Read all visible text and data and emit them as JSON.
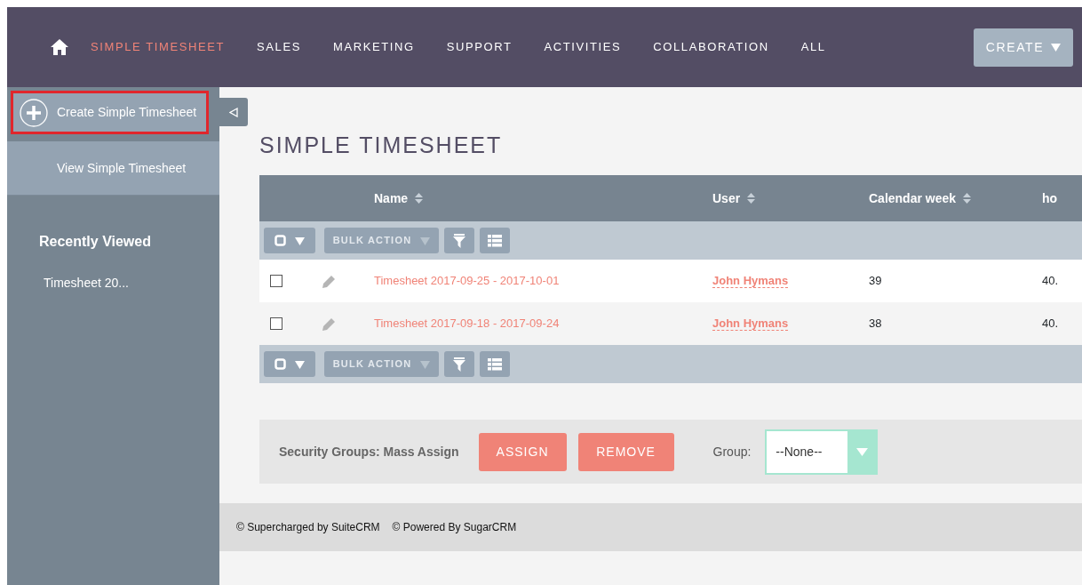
{
  "nav": {
    "items": [
      {
        "label": "SIMPLE TIMESHEET",
        "selected": true
      },
      {
        "label": "SALES",
        "selected": false
      },
      {
        "label": "MARKETING",
        "selected": false
      },
      {
        "label": "SUPPORT",
        "selected": false
      },
      {
        "label": "ACTIVITIES",
        "selected": false
      },
      {
        "label": "COLLABORATION",
        "selected": false
      },
      {
        "label": "ALL",
        "selected": false
      }
    ],
    "create_button": "CREATE"
  },
  "sidebar": {
    "actions": [
      {
        "label": "Create Simple Timesheet",
        "kind": "create",
        "highlighted": true
      },
      {
        "label": "View Simple Timesheet",
        "kind": "view",
        "highlighted": false
      }
    ],
    "recently_viewed": {
      "title": "Recently Viewed",
      "items": [
        "Timesheet 20..."
      ]
    }
  },
  "page_title": "SIMPLE TIMESHEET",
  "table": {
    "columns": [
      {
        "label": "Name",
        "sortable": true
      },
      {
        "label": "User",
        "sortable": true
      },
      {
        "label": "Calendar week",
        "sortable": true
      },
      {
        "label": "ho"
      }
    ],
    "action_bars": [
      {
        "bulk_action": "BULK ACTION"
      },
      {
        "bulk_action": "BULK ACTION"
      }
    ],
    "rows": [
      {
        "checked": false,
        "name": "Timesheet 2017-09-25 - 2017-10-01",
        "user": "John Hymans",
        "calendar_week": "39",
        "column_4": "40."
      },
      {
        "checked": false,
        "name": "Timesheet 2017-09-18 - 2017-09-24",
        "user": "John Hymans",
        "calendar_week": "38",
        "column_4": "40."
      }
    ]
  },
  "security": {
    "label": "Security Groups: Mass Assign",
    "buttons": [
      "ASSIGN",
      "REMOVE"
    ],
    "group_label": "Group:",
    "group_value": "--None--"
  },
  "footer": [
    "© Supercharged by SuiteCRM",
    "© Powered By SugarCRM"
  ]
}
